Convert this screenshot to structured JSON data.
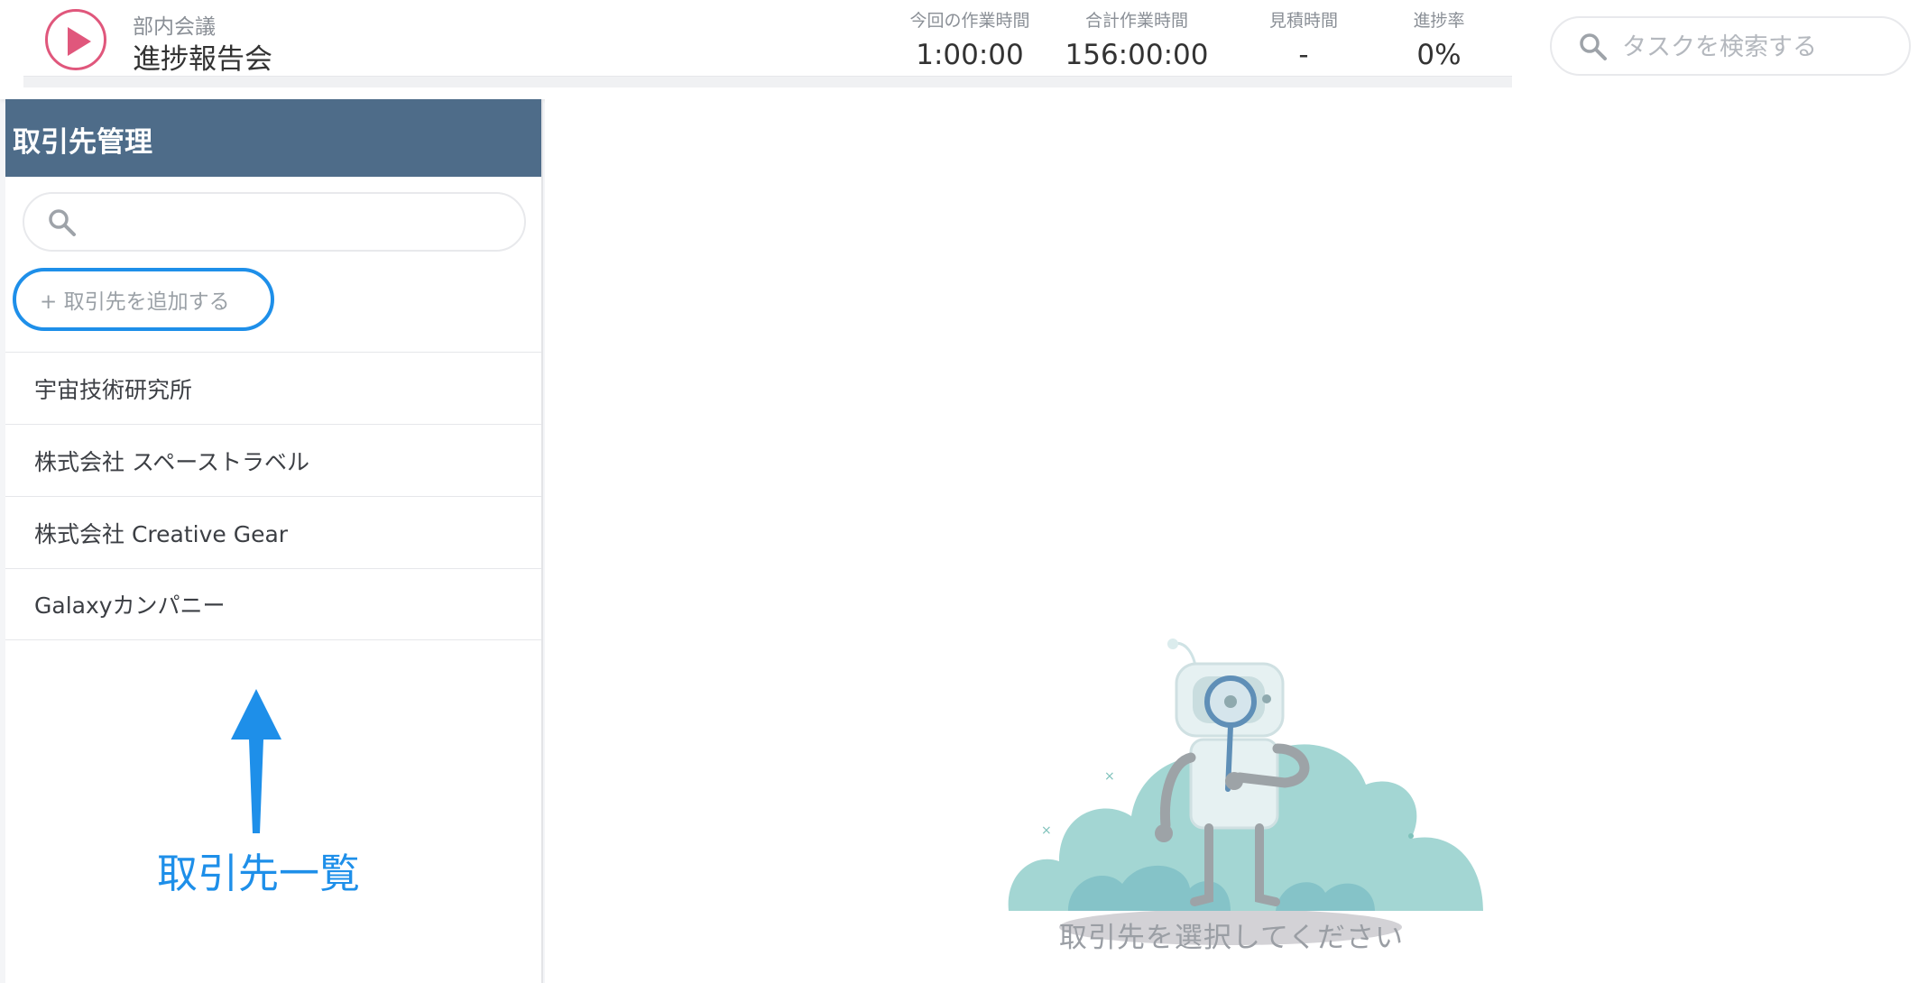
{
  "header": {
    "project_category": "部内会議",
    "project_name": "進捗報告会",
    "stats": [
      {
        "label": "今回の作業時間",
        "value": "1:00:00"
      },
      {
        "label": "合計作業時間",
        "value": "156:00:00"
      },
      {
        "label": "見積時間",
        "value": "-"
      },
      {
        "label": "進捗率",
        "value": "0%"
      }
    ],
    "search_placeholder": "タスクを検索する"
  },
  "sidebar": {
    "title": "取引先管理",
    "search_placeholder": "",
    "add_button_label": "+ 取引先を追加する",
    "clients": [
      "宇宙技術研究所",
      "株式会社 スペーストラベル",
      "株式会社 Creative Gear",
      "Galaxyカンパニー"
    ]
  },
  "annotation": {
    "label": "取引先一覧",
    "color": "#1e8fe9"
  },
  "main": {
    "empty_message": "取引先を選択してください"
  },
  "colors": {
    "sidebar_header": "#4e6c89",
    "accent_blue": "#1e8fe9",
    "play_pink": "#e0577c"
  },
  "icons": {
    "play": "play-icon",
    "search": "search-icon",
    "arrow": "arrow-up-icon",
    "illustration": "robot-magnifier-illustration"
  }
}
